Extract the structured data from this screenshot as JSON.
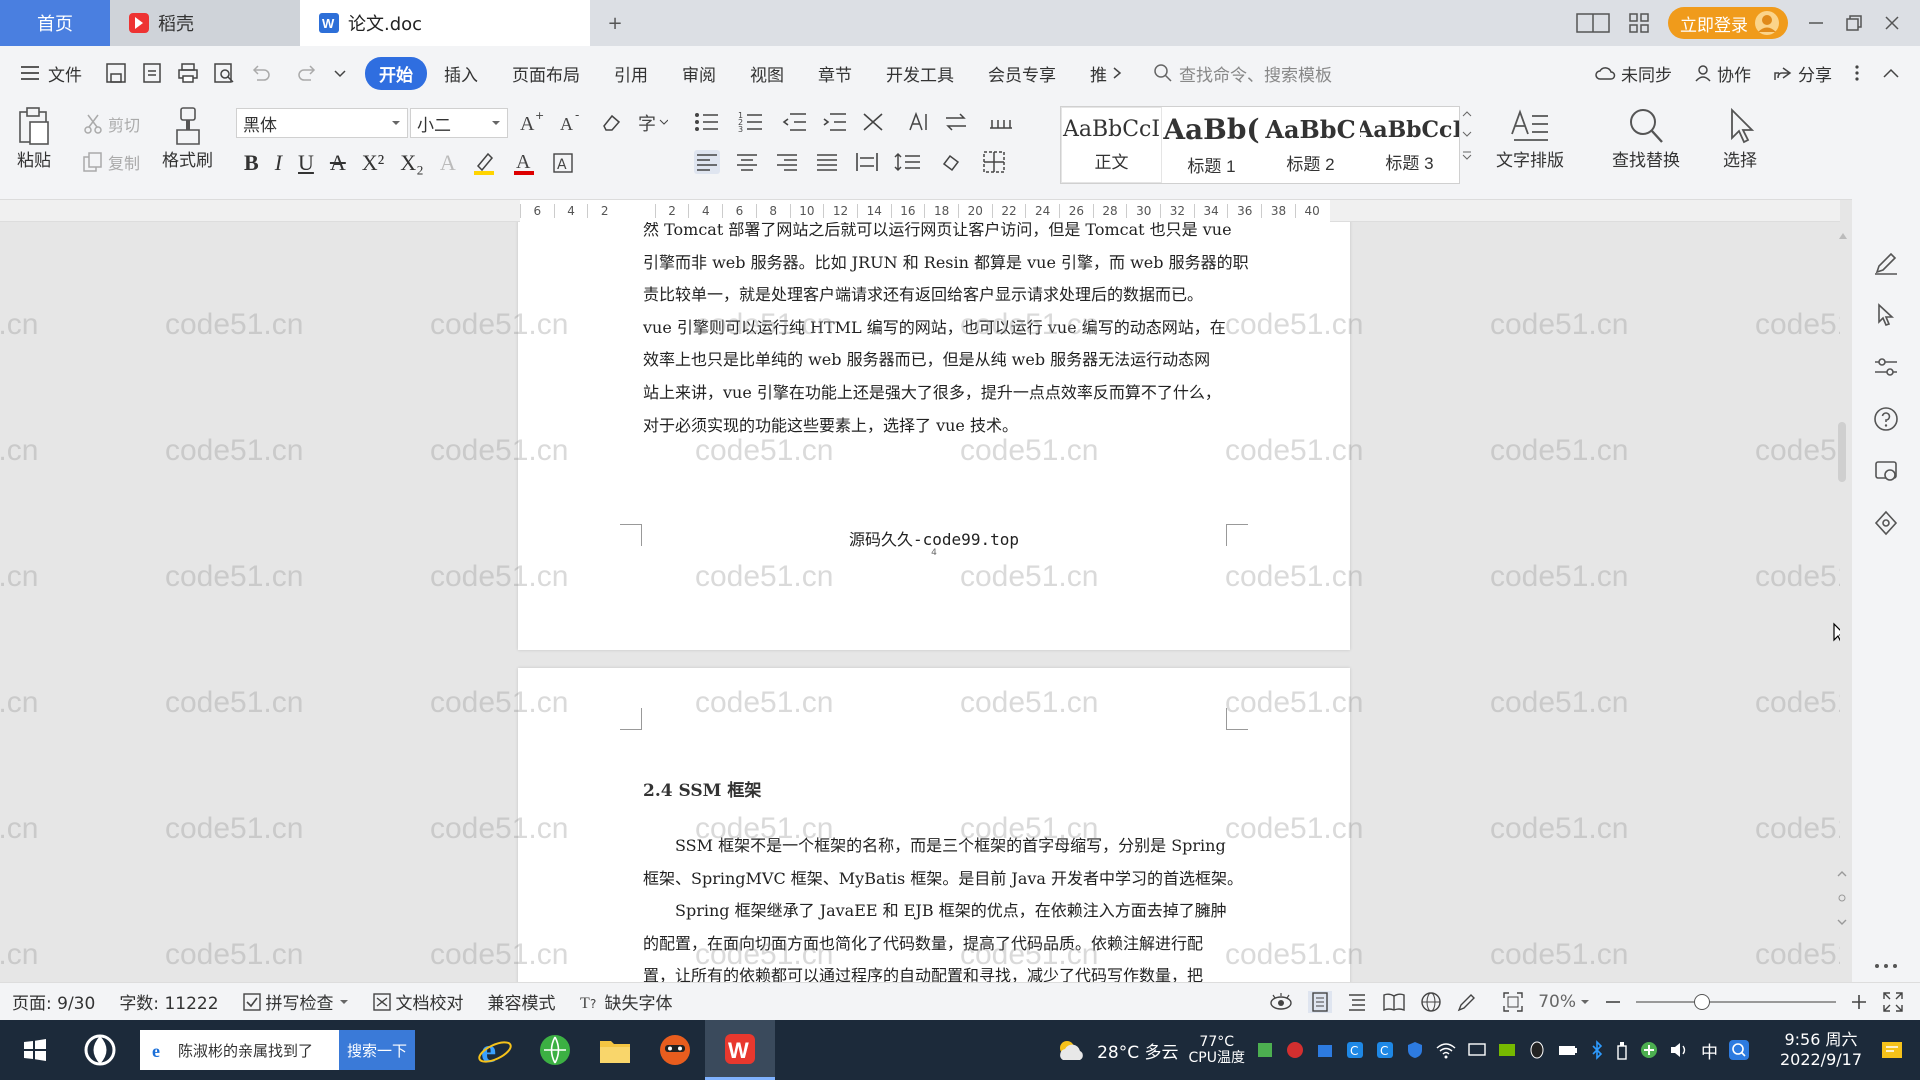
{
  "tabs": {
    "home": "首页",
    "daoke": "稻壳",
    "doc": "论文.doc",
    "add": "+"
  },
  "titlebar": {
    "login": "立即登录"
  },
  "menu": {
    "file": "文件",
    "items": [
      "开始",
      "插入",
      "页面布局",
      "引用",
      "审阅",
      "视图",
      "章节",
      "开发工具",
      "会员专享",
      "推"
    ],
    "active": "开始",
    "search_placeholder": "查找命令、搜索模板",
    "sync": "未同步",
    "collab": "协作",
    "share": "分享"
  },
  "ribbon": {
    "paste": "粘贴",
    "cut": "剪切",
    "copy": "复制",
    "format_painter": "格式刷",
    "font_name": "黑体",
    "font_size": "小二",
    "styles": [
      {
        "preview": "AaBbCcI",
        "name": "正文"
      },
      {
        "preview": "AaBb(",
        "name": "标题 1"
      },
      {
        "preview": "AaBbC",
        "name": "标题 2"
      },
      {
        "preview": "AaBbCcI",
        "name": "标题 3"
      }
    ],
    "text_layout": "文字排版",
    "find_replace": "查找替换",
    "select": "选择"
  },
  "ruler": {
    "ticks": [
      "6",
      "4",
      "2",
      "",
      "2",
      "4",
      "6",
      "8",
      "10",
      "12",
      "14",
      "16",
      "18",
      "20",
      "22",
      "24",
      "26",
      "28",
      "30",
      "32",
      "34",
      "36",
      "38",
      "40"
    ]
  },
  "document": {
    "page1_lines": [
      "然 Tomcat 部署了网站之后就可以运行网页让客户访问，但是 Tomcat 也只是 vue",
      "引擎而非 web 服务器。比如 JRUN 和 Resin 都算是 vue 引擎，而 web 服务器的职",
      "责比较单一，就是处理客户端请求还有返回给客户显示请求处理后的数据而已。",
      "vue 引擎则可以运行纯 HTML 编写的网站，也可以运行 vue 编写的动态网站，在",
      "效率上也只是比单纯的 web 服务器而已，但是从纯 web 服务器无法运行动态网",
      "站上来讲，vue 引擎在功能上还是强大了很多，提升一点点效率反而算不了什么，",
      "对于必须实现的功能这些要素上，选择了 vue 技术。"
    ],
    "footer": "源码久久-code99.top",
    "page_number": "4",
    "heading": "2.4 SSM 框架",
    "page2_lines": [
      "SSM 框架不是一个框架的名称，而是三个框架的首字母缩写，分别是 Spring",
      "框架、SpringMVC 框架、MyBatis 框架。是目前 Java 开发者中学习的首选框架。",
      "Spring 框架继承了 JavaEE 和 EJB 框架的优点，在依赖注入方面去掉了臃肿",
      "的配置，在面向切面方面也简化了代码数量，提高了代码品质。依赖注解进行配",
      "置，让所有的依赖都可以通过程序的自动配置和寻找，减少了代码写作数量，把"
    ],
    "watermark": "code51.cn"
  },
  "status": {
    "page": "页面: 9/30",
    "words": "字数: 11222",
    "spell": "拼写检查",
    "proof": "文档校对",
    "compat": "兼容模式",
    "missing_font": "缺失字体",
    "zoom": "70%"
  },
  "taskbar": {
    "search_text": "陈淑彬的亲属找到了",
    "search_button": "搜索一下",
    "weather": "28°C 多云",
    "cpu_temp": "77°C",
    "cpu_label": "CPU温度",
    "ime": "中",
    "time": "9:56 周六",
    "date": "2022/9/17"
  },
  "colors": {
    "accent": "#2f6ee0",
    "login": "#f09b1b",
    "taskbar": "#1c2a3a"
  }
}
